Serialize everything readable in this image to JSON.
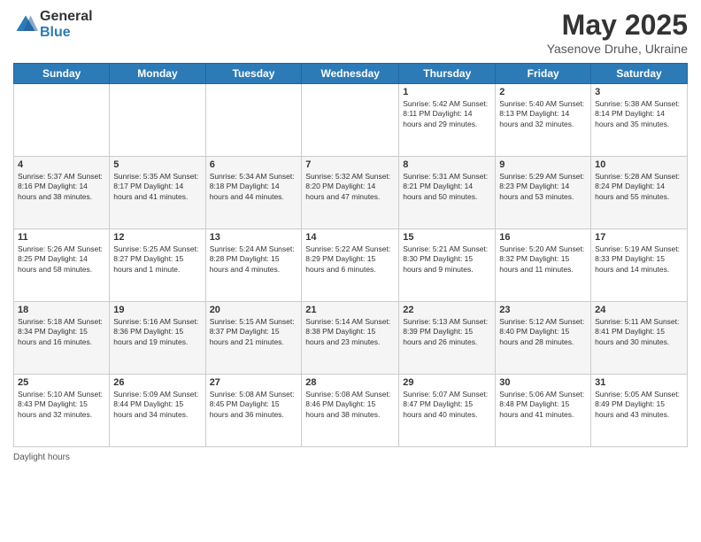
{
  "header": {
    "logo_line1": "General",
    "logo_line2": "Blue",
    "title": "May 2025",
    "location": "Yasenove Druhe, Ukraine"
  },
  "calendar": {
    "days_of_week": [
      "Sunday",
      "Monday",
      "Tuesday",
      "Wednesday",
      "Thursday",
      "Friday",
      "Saturday"
    ],
    "weeks": [
      [
        {
          "day": "",
          "info": ""
        },
        {
          "day": "",
          "info": ""
        },
        {
          "day": "",
          "info": ""
        },
        {
          "day": "",
          "info": ""
        },
        {
          "day": "1",
          "info": "Sunrise: 5:42 AM\nSunset: 8:11 PM\nDaylight: 14 hours\nand 29 minutes."
        },
        {
          "day": "2",
          "info": "Sunrise: 5:40 AM\nSunset: 8:13 PM\nDaylight: 14 hours\nand 32 minutes."
        },
        {
          "day": "3",
          "info": "Sunrise: 5:38 AM\nSunset: 8:14 PM\nDaylight: 14 hours\nand 35 minutes."
        }
      ],
      [
        {
          "day": "4",
          "info": "Sunrise: 5:37 AM\nSunset: 8:16 PM\nDaylight: 14 hours\nand 38 minutes."
        },
        {
          "day": "5",
          "info": "Sunrise: 5:35 AM\nSunset: 8:17 PM\nDaylight: 14 hours\nand 41 minutes."
        },
        {
          "day": "6",
          "info": "Sunrise: 5:34 AM\nSunset: 8:18 PM\nDaylight: 14 hours\nand 44 minutes."
        },
        {
          "day": "7",
          "info": "Sunrise: 5:32 AM\nSunset: 8:20 PM\nDaylight: 14 hours\nand 47 minutes."
        },
        {
          "day": "8",
          "info": "Sunrise: 5:31 AM\nSunset: 8:21 PM\nDaylight: 14 hours\nand 50 minutes."
        },
        {
          "day": "9",
          "info": "Sunrise: 5:29 AM\nSunset: 8:23 PM\nDaylight: 14 hours\nand 53 minutes."
        },
        {
          "day": "10",
          "info": "Sunrise: 5:28 AM\nSunset: 8:24 PM\nDaylight: 14 hours\nand 55 minutes."
        }
      ],
      [
        {
          "day": "11",
          "info": "Sunrise: 5:26 AM\nSunset: 8:25 PM\nDaylight: 14 hours\nand 58 minutes."
        },
        {
          "day": "12",
          "info": "Sunrise: 5:25 AM\nSunset: 8:27 PM\nDaylight: 15 hours\nand 1 minute."
        },
        {
          "day": "13",
          "info": "Sunrise: 5:24 AM\nSunset: 8:28 PM\nDaylight: 15 hours\nand 4 minutes."
        },
        {
          "day": "14",
          "info": "Sunrise: 5:22 AM\nSunset: 8:29 PM\nDaylight: 15 hours\nand 6 minutes."
        },
        {
          "day": "15",
          "info": "Sunrise: 5:21 AM\nSunset: 8:30 PM\nDaylight: 15 hours\nand 9 minutes."
        },
        {
          "day": "16",
          "info": "Sunrise: 5:20 AM\nSunset: 8:32 PM\nDaylight: 15 hours\nand 11 minutes."
        },
        {
          "day": "17",
          "info": "Sunrise: 5:19 AM\nSunset: 8:33 PM\nDaylight: 15 hours\nand 14 minutes."
        }
      ],
      [
        {
          "day": "18",
          "info": "Sunrise: 5:18 AM\nSunset: 8:34 PM\nDaylight: 15 hours\nand 16 minutes."
        },
        {
          "day": "19",
          "info": "Sunrise: 5:16 AM\nSunset: 8:36 PM\nDaylight: 15 hours\nand 19 minutes."
        },
        {
          "day": "20",
          "info": "Sunrise: 5:15 AM\nSunset: 8:37 PM\nDaylight: 15 hours\nand 21 minutes."
        },
        {
          "day": "21",
          "info": "Sunrise: 5:14 AM\nSunset: 8:38 PM\nDaylight: 15 hours\nand 23 minutes."
        },
        {
          "day": "22",
          "info": "Sunrise: 5:13 AM\nSunset: 8:39 PM\nDaylight: 15 hours\nand 26 minutes."
        },
        {
          "day": "23",
          "info": "Sunrise: 5:12 AM\nSunset: 8:40 PM\nDaylight: 15 hours\nand 28 minutes."
        },
        {
          "day": "24",
          "info": "Sunrise: 5:11 AM\nSunset: 8:41 PM\nDaylight: 15 hours\nand 30 minutes."
        }
      ],
      [
        {
          "day": "25",
          "info": "Sunrise: 5:10 AM\nSunset: 8:43 PM\nDaylight: 15 hours\nand 32 minutes."
        },
        {
          "day": "26",
          "info": "Sunrise: 5:09 AM\nSunset: 8:44 PM\nDaylight: 15 hours\nand 34 minutes."
        },
        {
          "day": "27",
          "info": "Sunrise: 5:08 AM\nSunset: 8:45 PM\nDaylight: 15 hours\nand 36 minutes."
        },
        {
          "day": "28",
          "info": "Sunrise: 5:08 AM\nSunset: 8:46 PM\nDaylight: 15 hours\nand 38 minutes."
        },
        {
          "day": "29",
          "info": "Sunrise: 5:07 AM\nSunset: 8:47 PM\nDaylight: 15 hours\nand 40 minutes."
        },
        {
          "day": "30",
          "info": "Sunrise: 5:06 AM\nSunset: 8:48 PM\nDaylight: 15 hours\nand 41 minutes."
        },
        {
          "day": "31",
          "info": "Sunrise: 5:05 AM\nSunset: 8:49 PM\nDaylight: 15 hours\nand 43 minutes."
        }
      ]
    ]
  },
  "footer": {
    "text": "Daylight hours"
  }
}
